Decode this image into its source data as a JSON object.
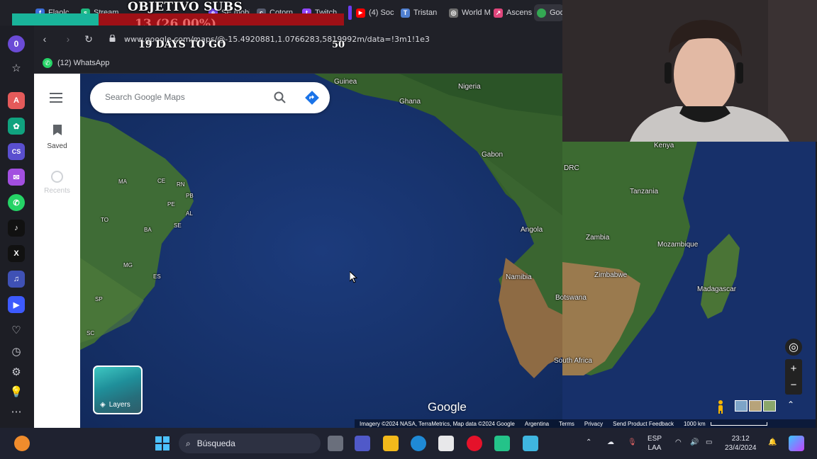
{
  "browser": {
    "tabs": [
      {
        "label": "Flaolc",
        "color": "#3b6dd8",
        "glyph": "f"
      },
      {
        "label": "Stream",
        "color": "#1eb980",
        "glyph": "s"
      },
      {
        "label": "SE mobile",
        "color": "#7c4dff",
        "glyph": "e"
      },
      {
        "label": "Cotorn",
        "color": "#555b6e",
        "glyph": "c"
      },
      {
        "label": "Twitch",
        "color": "#9146ff",
        "glyph": "t"
      },
      {
        "label": "(4) Soc",
        "color": "#ff0000",
        "glyph": "▶"
      },
      {
        "label": "Tristan",
        "color": "#4f7fd0",
        "glyph": "T"
      },
      {
        "label": "World M",
        "color": "#6f6f6f",
        "glyph": "◎"
      },
      {
        "label": "Ascens",
        "color": "#e0467c",
        "glyph": "↗"
      },
      {
        "label": "Goo",
        "color": "#34a853",
        "glyph": "⬤"
      }
    ],
    "url": "www.google.com/maps/@-15.4920881,1.0766283,5819992m/data=!3m1!1e3",
    "bookmark": "(12) WhatsApp"
  },
  "overlay": {
    "title": "OBJETIVO SUBS",
    "progress": "13 (26.00%)",
    "days_left": "19 DAYS TO GO",
    "goal": "50"
  },
  "sidebar": {
    "notification_count": "0",
    "apps": [
      {
        "name": "aria",
        "color": "#e45a5a",
        "glyph": "A"
      },
      {
        "name": "chatgpt",
        "color": "#10a37f",
        "glyph": "✿"
      },
      {
        "name": "cs",
        "color": "#5a4fcf",
        "glyph": "CS"
      },
      {
        "name": "messenger",
        "color": "#a24fe0",
        "glyph": "✉"
      },
      {
        "name": "whatsapp",
        "color": "#25d366",
        "glyph": "✆"
      },
      {
        "name": "tiktok",
        "color": "#111111",
        "glyph": "♪"
      },
      {
        "name": "x",
        "color": "#111111",
        "glyph": "X"
      },
      {
        "name": "music",
        "color": "#3f51b5",
        "glyph": "♫"
      },
      {
        "name": "player",
        "color": "#3d5afe",
        "glyph": "▶"
      }
    ]
  },
  "maps": {
    "search_placeholder": "Search Google Maps",
    "saved_label": "Saved",
    "recents_label": "Recents",
    "layers_label": "Layers",
    "logo": "Google",
    "attribution": {
      "imagery": "Imagery ©2024 NASA, TerraMetrics, Map data ©2024 Google",
      "country": "Argentina",
      "terms": "Terms",
      "privacy": "Privacy",
      "feedback": "Send Product Feedback",
      "scale": "1000 km"
    },
    "labels": {
      "guinea": "Guinea",
      "nigeria": "Nigeria",
      "ghana": "Ghana",
      "gabon": "Gabon",
      "drc": "DRC",
      "kenya": "Kenya",
      "tanzania": "Tanzania",
      "angola": "Angola",
      "zambia": "Zambia",
      "mozambique": "Mozambique",
      "namibia": "Namibia",
      "zimbabwe": "Zimbabwe",
      "madagascar": "Madagascar",
      "botswana": "Botswana",
      "south_africa": "South Africa",
      "ma": "MA",
      "ce": "CE",
      "rn": "RN",
      "pb": "PB",
      "pe": "PE",
      "al": "AL",
      "to": "TO",
      "ba": "BA",
      "se": "SE",
      "mg": "MG",
      "es": "ES",
      "sp": "SP",
      "sc": "SC"
    }
  },
  "taskbar": {
    "search_label": "Búsqueda",
    "language": "ESP",
    "layout": "LAA",
    "time": "23:12",
    "date": "23/4/2024"
  }
}
